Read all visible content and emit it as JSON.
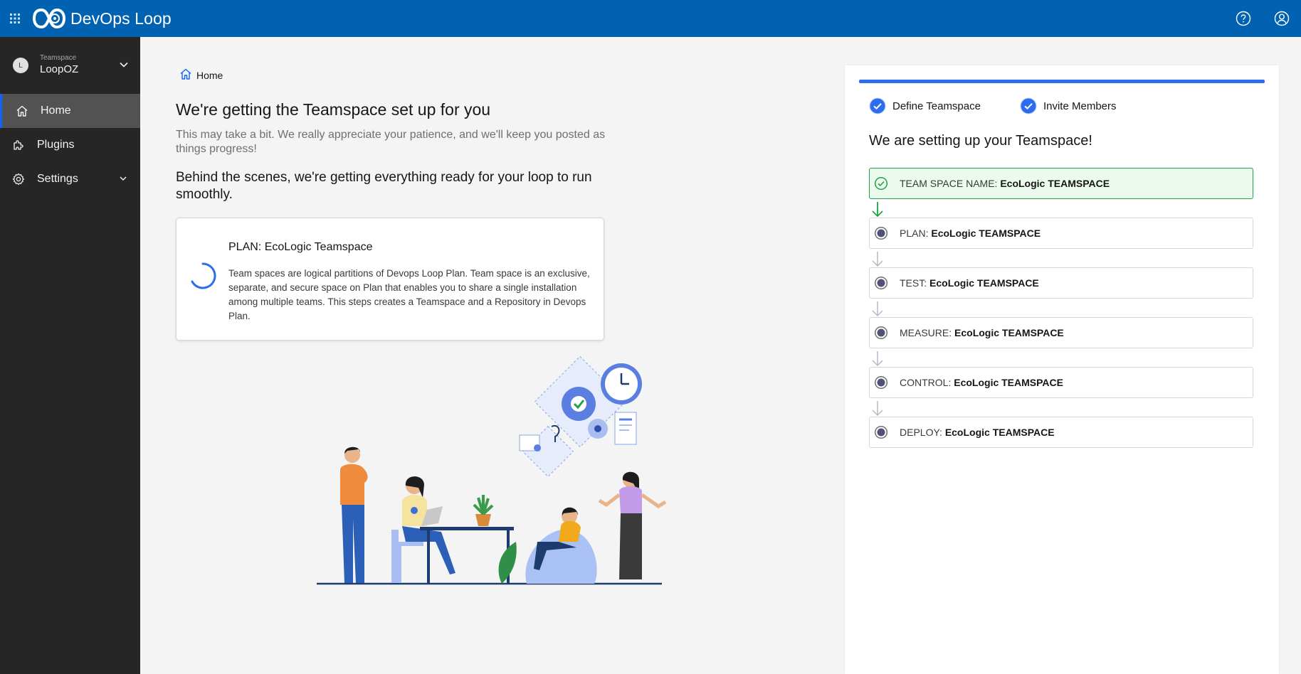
{
  "app": {
    "title": "DevOps Loop"
  },
  "header": {
    "icons": [
      "apps-grid-icon",
      "help-icon",
      "user-profile-icon"
    ]
  },
  "sidebar": {
    "team_caption": "Teamspace",
    "team_name": "LoopOZ",
    "team_avatar": "L",
    "items": [
      {
        "label": "Home",
        "icon": "home-icon",
        "active": true
      },
      {
        "label": "Plugins",
        "icon": "plugin-icon",
        "active": false
      },
      {
        "label": "Settings",
        "icon": "gear-icon",
        "active": false
      }
    ]
  },
  "main": {
    "breadcrumb": "Home",
    "title": "We're getting the Teamspace set up for you",
    "subtitle": "This may take a bit. We really appreciate your patience, and we'll keep you posted as things progress!",
    "heading2": "Behind the scenes, we're getting everything ready for your loop to run smoothly.",
    "plan_card": {
      "title": "PLAN: EcoLogic Teamspace",
      "description": "Team spaces are logical partitions of Devops Loop Plan. Team space is an exclusive, separate, and secure space on Plan that enables you to share a single installation among multiple teams. This steps creates a Teamspace and a Repository in Devops Plan."
    }
  },
  "panel": {
    "progress": 1.0,
    "steps": [
      {
        "label": "Define Teamspace",
        "done": true
      },
      {
        "label": "Invite Members",
        "done": true
      }
    ],
    "title": "We are setting up your Teamspace!",
    "stages": [
      {
        "prefix": "TEAM SPACE NAME:",
        "value": "EcoLogic TEAMSPACE",
        "status": "done"
      },
      {
        "prefix": "PLAN:",
        "value": "EcoLogic TEAMSPACE",
        "status": "pending"
      },
      {
        "prefix": "TEST:",
        "value": "EcoLogic TEAMSPACE",
        "status": "pending"
      },
      {
        "prefix": "MEASURE:",
        "value": "EcoLogic TEAMSPACE",
        "status": "pending"
      },
      {
        "prefix": "CONTROL:",
        "value": "EcoLogic TEAMSPACE",
        "status": "pending"
      },
      {
        "prefix": "DEPLOY:",
        "value": "EcoLogic TEAMSPACE",
        "status": "pending"
      }
    ]
  },
  "colors": {
    "header": "#0062b1",
    "sidebar": "#262626",
    "accent": "#2c6df0",
    "success": "#1ea544"
  }
}
